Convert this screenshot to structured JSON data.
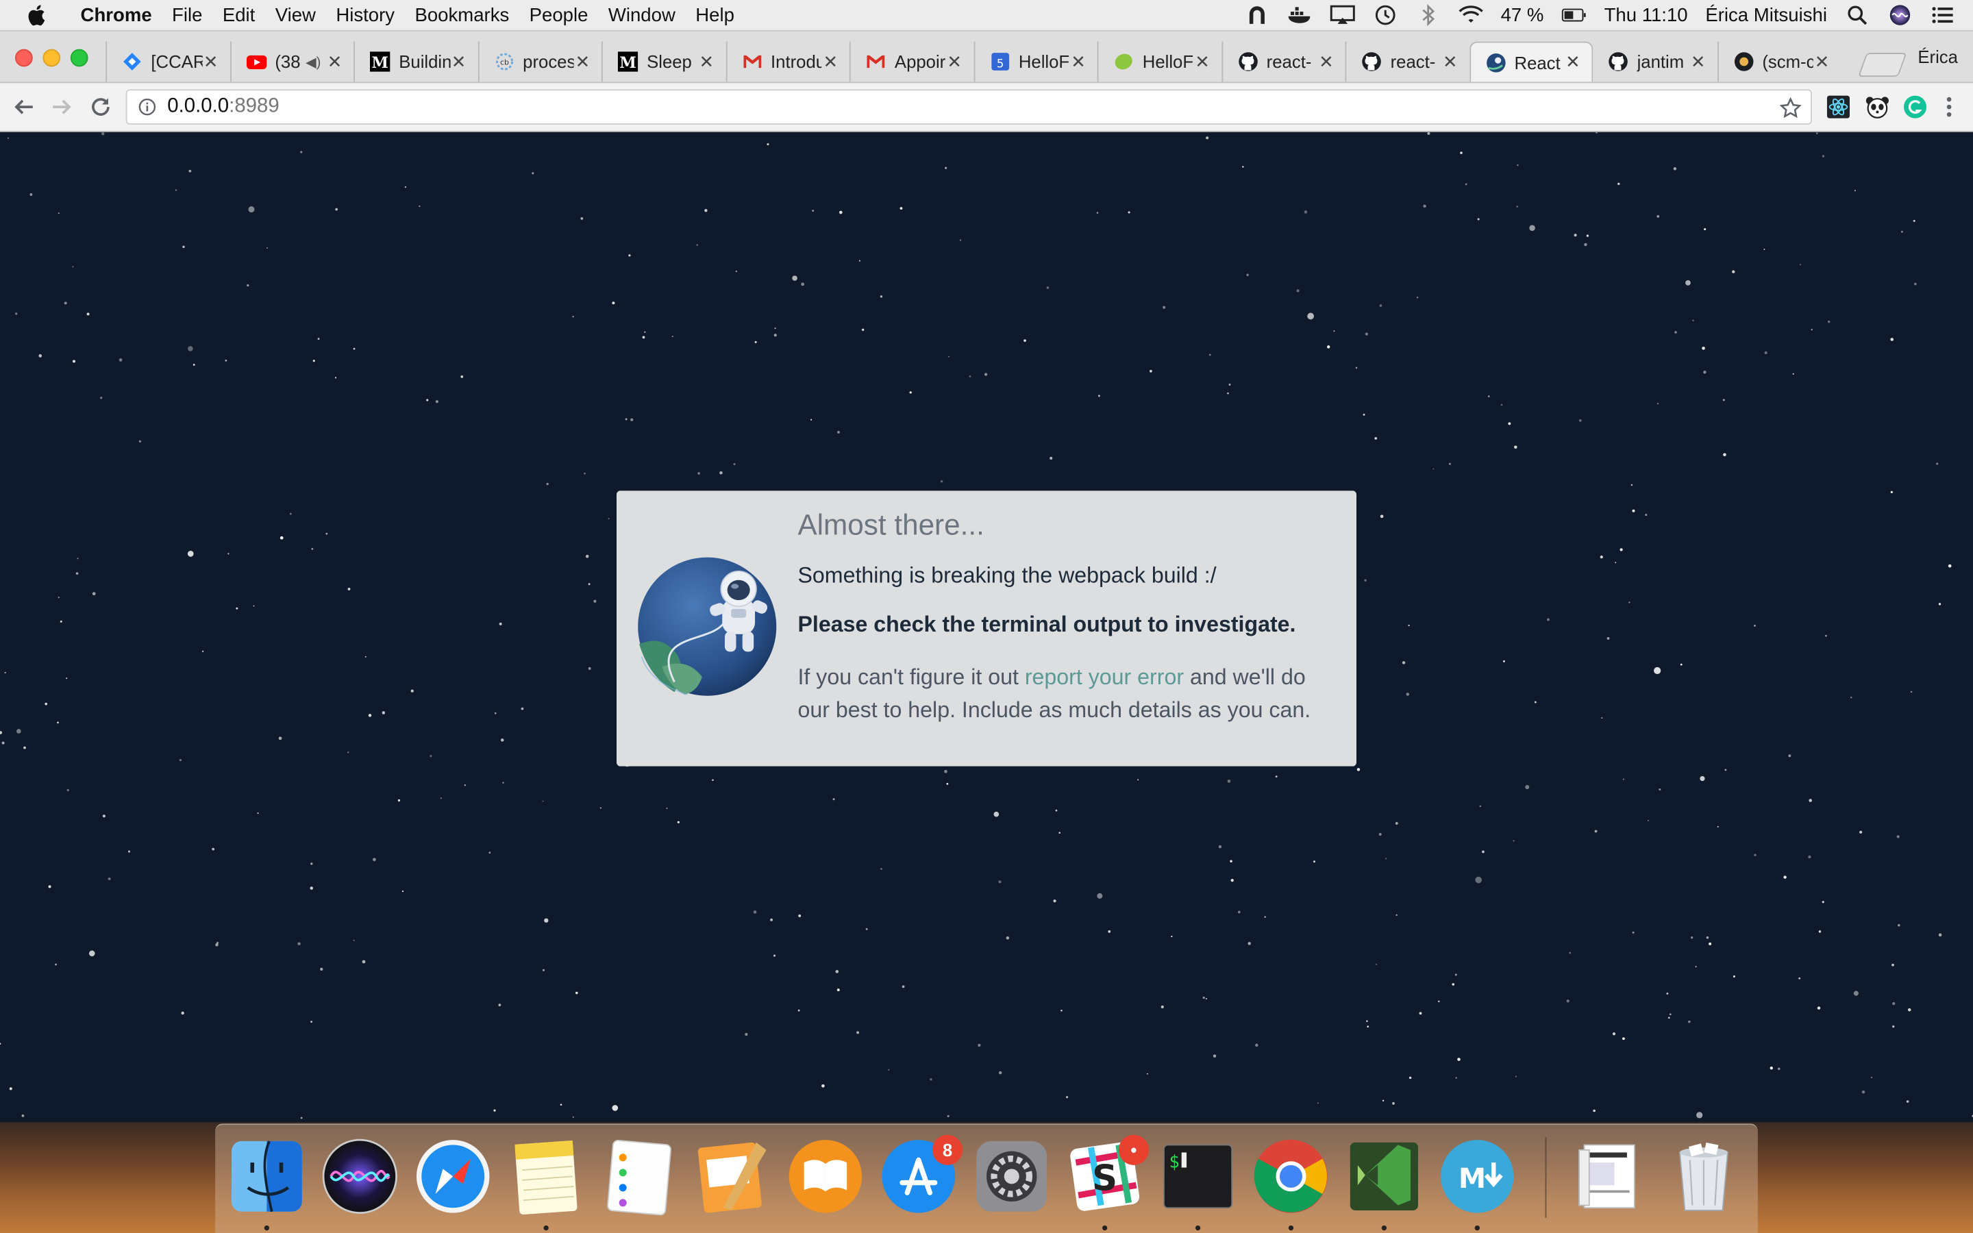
{
  "menubar": {
    "app_name": "Chrome",
    "items": [
      "File",
      "Edit",
      "View",
      "History",
      "Bookmarks",
      "People",
      "Window",
      "Help"
    ],
    "battery_text": "47 %",
    "clock": "Thu 11:10",
    "user_name": "Érica Mitsuishi",
    "icons": [
      "vpn-icon",
      "docker-icon",
      "airplay-icon",
      "time-machine-icon",
      "bluetooth-icon",
      "wifi-icon",
      "battery-icon",
      "spotlight-icon",
      "siri-icon",
      "notification-center-icon"
    ]
  },
  "browser": {
    "profile_name": "Érica",
    "tabs": [
      {
        "title": "[CCAR",
        "icon": "jira-icon"
      },
      {
        "title": "(38",
        "icon": "youtube-icon",
        "audio": true
      },
      {
        "title": "Buildin",
        "icon": "medium-icon"
      },
      {
        "title": "proces",
        "icon": "cb-icon"
      },
      {
        "title": "Sleep",
        "icon": "medium-icon"
      },
      {
        "title": "Introdu",
        "icon": "gmail-icon"
      },
      {
        "title": "Appoir",
        "icon": "gmail-icon"
      },
      {
        "title": "HelloF",
        "icon": "calendar-icon"
      },
      {
        "title": "HelloF",
        "icon": "hellofresh-icon"
      },
      {
        "title": "react-",
        "icon": "github-icon"
      },
      {
        "title": "react-",
        "icon": "github-icon"
      },
      {
        "title": "React",
        "icon": "astronaut-icon",
        "active": true
      },
      {
        "title": "jantim",
        "icon": "github-icon"
      },
      {
        "title": "(scm-c",
        "icon": "github-icon"
      }
    ],
    "url_host": "0.0.0.0",
    "url_port": ":8989",
    "extensions": [
      "react-devtools-icon",
      "panda-icon",
      "grammarly-icon"
    ]
  },
  "error_card": {
    "title": "Almost there...",
    "line1": "Something is breaking the webpack build :/",
    "line2": "Please check the terminal output to investigate.",
    "help_before": "If you can't figure it out ",
    "help_link": "report your error",
    "help_after": " and we'll do our best to help. Include as much details as you can."
  },
  "dock": {
    "apps": [
      {
        "name": "Finder",
        "icon": "finder-icon",
        "running": true
      },
      {
        "name": "Siri",
        "icon": "siri-icon",
        "running": false
      },
      {
        "name": "Safari",
        "icon": "safari-icon",
        "running": false
      },
      {
        "name": "Notes",
        "icon": "notes-icon",
        "running": true
      },
      {
        "name": "Reminders",
        "icon": "reminders-icon",
        "running": false
      },
      {
        "name": "Pages",
        "icon": "pages-icon",
        "running": false
      },
      {
        "name": "iBooks",
        "icon": "ibooks-icon",
        "running": false
      },
      {
        "name": "App Store",
        "icon": "app-store-icon",
        "running": false,
        "badge": "8"
      },
      {
        "name": "System Preferences",
        "icon": "system-preferences-icon",
        "running": false
      },
      {
        "name": "Slack",
        "icon": "slack-icon",
        "running": true,
        "badge": "•"
      },
      {
        "name": "Terminal",
        "icon": "terminal-icon",
        "running": true
      },
      {
        "name": "Chrome",
        "icon": "chrome-icon",
        "running": true
      },
      {
        "name": "Visual Studio Code",
        "icon": "vscode-icon",
        "running": true
      },
      {
        "name": "Markdown",
        "icon": "markdown-icon",
        "running": true
      },
      {
        "name": "Downloads",
        "icon": "downloads-stack-icon",
        "running": false
      },
      {
        "name": "Trash",
        "icon": "trash-icon",
        "running": false
      }
    ]
  },
  "colors": {
    "page_bg": "#0e1a2b",
    "card_bg": "#dcdedf",
    "link": "#5b9a97",
    "badge": "#e8412f"
  }
}
